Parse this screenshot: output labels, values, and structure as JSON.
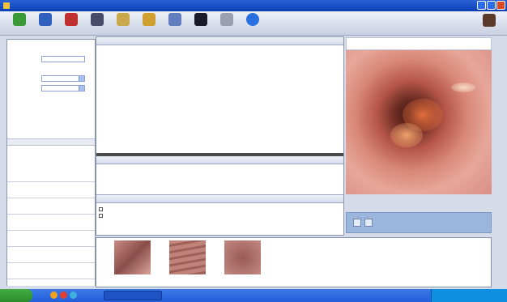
{
  "window": {
    "title": ""
  },
  "toolbar": {
    "buttons": [
      {
        "label": "",
        "icon": "patient-add-icon",
        "color": "#3a9a3a"
      },
      {
        "label": "",
        "icon": "patient-icon",
        "color": "#2f5fbf"
      },
      {
        "label": "",
        "icon": "patient-remove-icon",
        "color": "#c03030"
      },
      {
        "label": "",
        "icon": "doctor-icon",
        "color": "#4a4a6a"
      },
      {
        "label": "",
        "icon": "report-icon",
        "color": "#c9a94a"
      },
      {
        "label": "",
        "icon": "edit-icon",
        "color": "#d0a030"
      },
      {
        "label": "",
        "icon": "document-icon",
        "color": "#5f7fbf"
      },
      {
        "label": "",
        "icon": "monitor-icon",
        "color": "#1a1a2a"
      },
      {
        "label": "",
        "icon": "tools-icon",
        "color": "#9aa0b0"
      },
      {
        "label": "",
        "icon": "info-icon",
        "color": "#2a6fe0"
      }
    ],
    "exit_label": "",
    "exit_icon": "exit-icon"
  },
  "form": {
    "fields": [
      {
        "label": "",
        "value": ""
      },
      {
        "label": "",
        "value": ""
      },
      {
        "label": "",
        "value": ""
      },
      {
        "label": "",
        "value": ""
      },
      {
        "label": "",
        "value": ""
      },
      {
        "label": "",
        "value": ""
      }
    ]
  },
  "patient_list": {
    "columns": [
      "",
      ""
    ],
    "rows": [
      [
        "",
        ""
      ],
      [
        "",
        ""
      ]
    ]
  },
  "report": {
    "section1_title": "",
    "section2_title": "",
    "section3_title": "",
    "checks": [
      "",
      ""
    ]
  },
  "image_controls": {
    "label": ""
  },
  "thumbnails": [
    {
      "label": ""
    },
    {
      "label": ""
    },
    {
      "label": ""
    }
  ],
  "taskbar": {
    "start_label": "",
    "task_label": "",
    "tray_text": ""
  },
  "colors": {
    "titlebar": "#0a3fb4",
    "taskbar": "#245edb",
    "start": "#3fae3f"
  }
}
